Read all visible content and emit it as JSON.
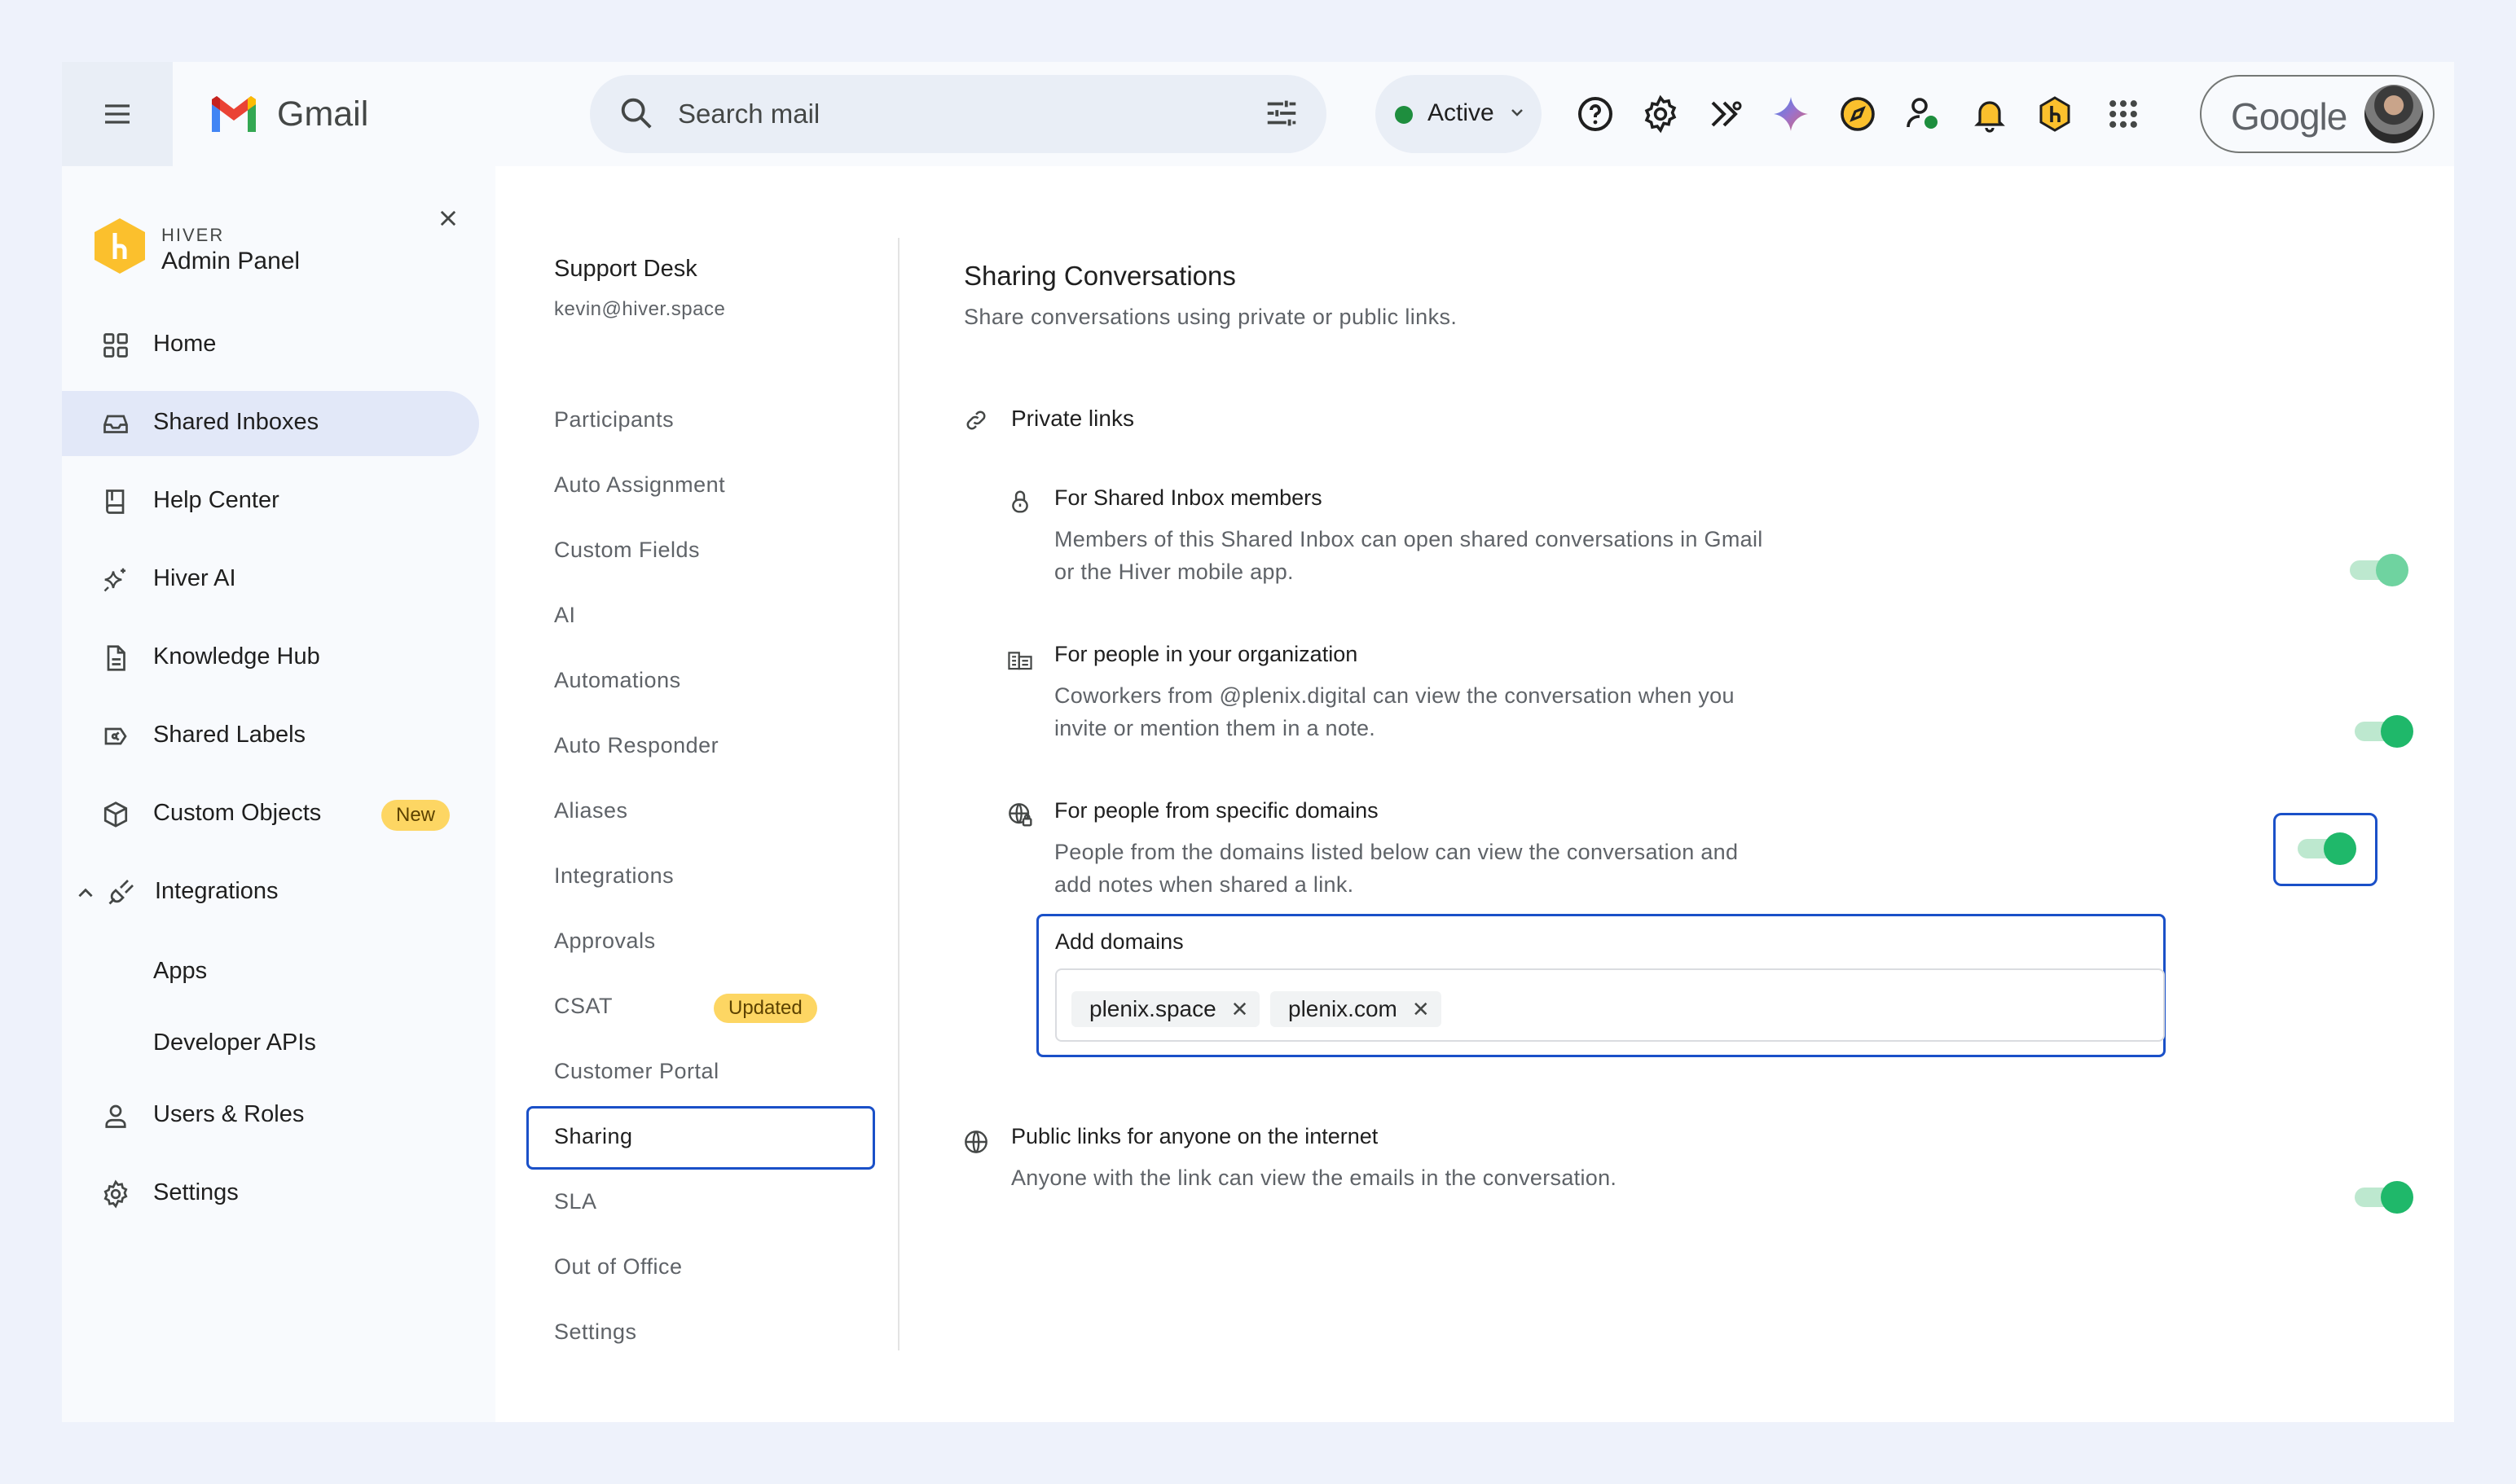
{
  "topbar": {
    "app_name": "Gmail",
    "search_placeholder": "Search mail",
    "status_label": "Active",
    "account_label": "Google"
  },
  "sidebar": {
    "brand_small": "HIVER",
    "brand_title": "Admin Panel",
    "items": [
      {
        "label": "Home",
        "icon": "grid-icon"
      },
      {
        "label": "Shared Inboxes",
        "icon": "inbox-icon"
      },
      {
        "label": "Help Center",
        "icon": "book-icon"
      },
      {
        "label": "Hiver AI",
        "icon": "sparkle-icon"
      },
      {
        "label": "Knowledge Hub",
        "icon": "document-icon"
      },
      {
        "label": "Shared Labels",
        "icon": "label-icon"
      },
      {
        "label": "Custom Objects",
        "icon": "cube-icon",
        "badge": "New"
      },
      {
        "label": "Integrations",
        "icon": "plug-icon"
      },
      {
        "label": "Users & Roles",
        "icon": "user-icon"
      },
      {
        "label": "Settings",
        "icon": "gear-icon"
      }
    ],
    "integration_subitems": [
      "Apps",
      "Developer APIs"
    ]
  },
  "inbox": {
    "name": "Support Desk",
    "email": "kevin@hiver.space",
    "items": [
      "Participants",
      "Auto Assignment",
      "Custom Fields",
      "AI",
      "Automations",
      "Auto Responder",
      "Aliases",
      "Integrations",
      "Approvals",
      "CSAT",
      "Customer Portal",
      "Sharing",
      "SLA",
      "Out of Office",
      "Settings"
    ],
    "csat_badge": "Updated",
    "active_item": "Sharing"
  },
  "content": {
    "title": "Sharing Conversations",
    "subtitle": "Share conversations using private or public links.",
    "private_links": {
      "heading": "Private links",
      "options": [
        {
          "title": "For Shared Inbox members",
          "desc_line1": "Members of this Shared Inbox can open shared conversations in Gmail",
          "desc_line2": "or the Hiver mobile app.",
          "enabled": true
        },
        {
          "title": "For people in your organization",
          "desc_line1": "Coworkers from @plenix.digital can view the conversation when you",
          "desc_line2": "invite or mention them in a note.",
          "enabled": true
        },
        {
          "title": "For people from specific domains",
          "desc_line1": "People from the domains listed below can view the conversation and",
          "desc_line2": "add notes when shared a link.",
          "enabled": true
        }
      ],
      "domains_label": "Add domains",
      "domains": [
        "plenix.space",
        "plenix.com"
      ]
    },
    "public_links": {
      "heading": "Public links for anyone on the internet",
      "desc": "Anyone with the link can view the emails in the conversation.",
      "enabled": true
    }
  },
  "colors": {
    "accent": "#1a50c8",
    "toggle_on": "#1fb86a",
    "badge": "#fdd663",
    "active_nav": "#e2e8f8"
  }
}
